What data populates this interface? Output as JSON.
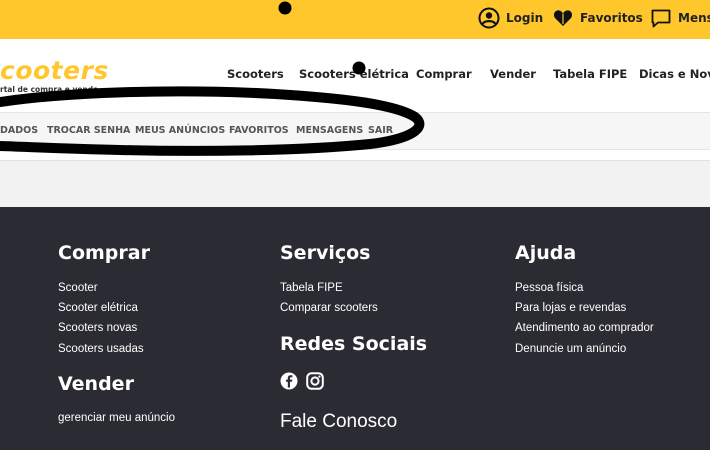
{
  "topbar": {
    "login": "Login",
    "favoritos": "Favoritos",
    "mensagens": "Mens"
  },
  "header": {
    "logo": "cooters",
    "tagline": "rtal de compra e venda",
    "nav": [
      "Scooters",
      "Scooters elétrica",
      "Comprar",
      "Vender",
      "Tabela FIPE",
      "Dicas e Novi"
    ]
  },
  "subnav": [
    "DADOS",
    "TROCAR SENHA",
    "MEUS ANÚNCIOS",
    "FAVORITOS",
    "MENSAGENS",
    "SAIR"
  ],
  "footer": {
    "comprar": {
      "title": "Comprar",
      "links": [
        "Scooter",
        "Scooter elétrica",
        "Scooters novas",
        "Scooters usadas"
      ]
    },
    "vender": {
      "title": "Vender",
      "links": [
        "gerenciar meu anúncio"
      ]
    },
    "servicos": {
      "title": "Serviços",
      "links": [
        "Tabela FIPE",
        "Comparar scooters"
      ]
    },
    "redes": {
      "title": "Redes Sociais",
      "icons": [
        "facebook-icon",
        "instagram-icon"
      ]
    },
    "fale": "Fale Conosco",
    "ajuda": {
      "title": "Ajuda",
      "links": [
        "Pessoa física",
        "Para lojas e revendas",
        "Atendimento ao comprador",
        "Denuncie um anúncio"
      ]
    }
  },
  "colors": {
    "brand_yellow": "#ffc72c",
    "footer_bg": "#2b2b33",
    "annotation_ink": "#000000"
  }
}
